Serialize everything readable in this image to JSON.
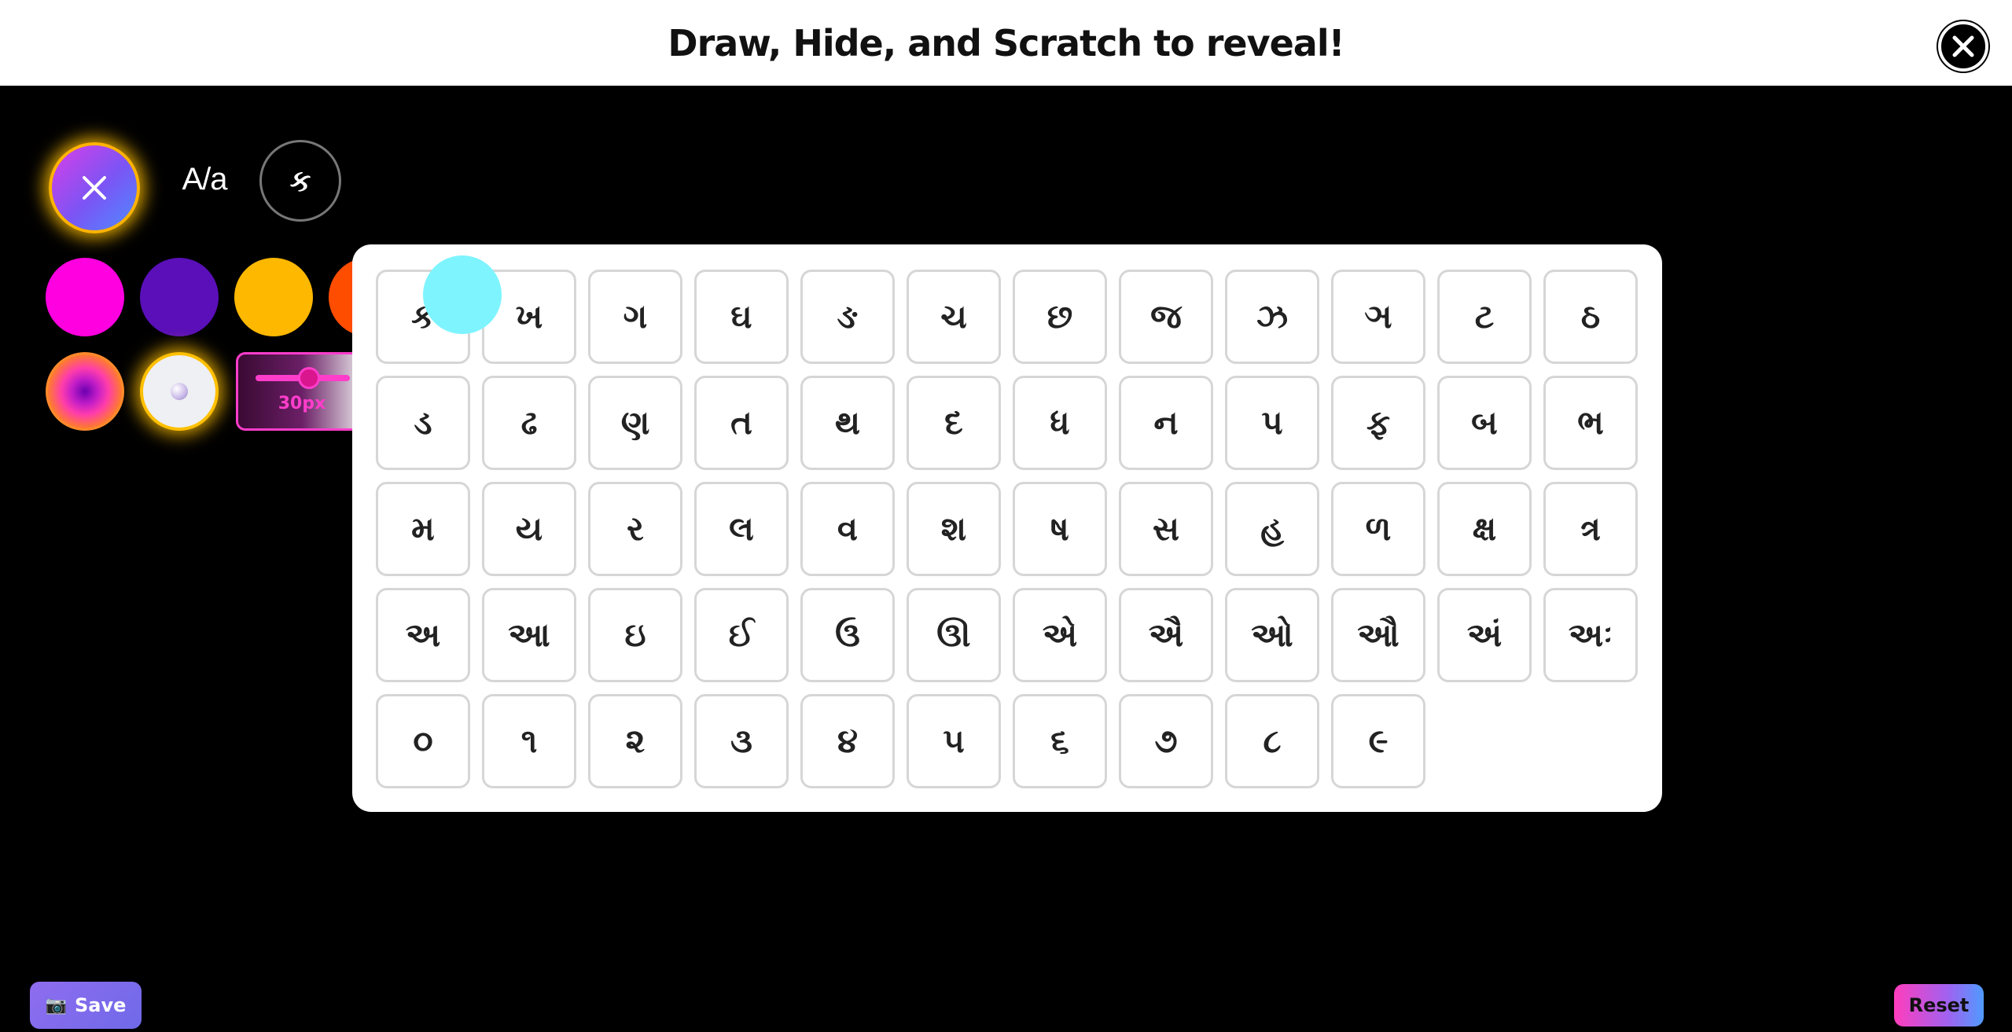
{
  "header": {
    "title": "Draw, Hide, and Scratch to reveal!"
  },
  "toolbar": {
    "case_toggle": "A/a",
    "letter_toggle": "ક",
    "brush_size": "30px",
    "brush_size_value": 30
  },
  "colors": {
    "swatches": [
      "#ff00e0",
      "#5a0fb8",
      "#ffb800",
      "#ff4d00",
      "#7ef4ff"
    ],
    "accent": "#ff3dcb",
    "selected_tool_glow": "#ffb300"
  },
  "keyboard": {
    "rows": [
      [
        "ક",
        "ખ",
        "ગ",
        "ઘ",
        "ઙ",
        "ચ",
        "છ",
        "જ",
        "ઝ",
        "ઞ",
        "ટ",
        "ઠ"
      ],
      [
        "ડ",
        "ઢ",
        "ણ",
        "ત",
        "થ",
        "દ",
        "ધ",
        "ન",
        "પ",
        "ફ",
        "બ",
        "ભ"
      ],
      [
        "મ",
        "ય",
        "ર",
        "લ",
        "વ",
        "શ",
        "ષ",
        "સ",
        "હ",
        "ળ",
        "ક્ષ",
        "ત્ર"
      ],
      [
        "અ",
        "આ",
        "ઇ",
        "ઈ",
        "ઉ",
        "ઊ",
        "એ",
        "ઐ",
        "ઓ",
        "ઔ",
        "અં",
        "અઃ"
      ],
      [
        "૦",
        "૧",
        "૨",
        "૩",
        "૪",
        "૫",
        "૬",
        "૭",
        "૮",
        "૯"
      ]
    ]
  },
  "footer": {
    "save_label": "Save",
    "save_icon": "camera-icon",
    "reset_label": "Reset"
  }
}
